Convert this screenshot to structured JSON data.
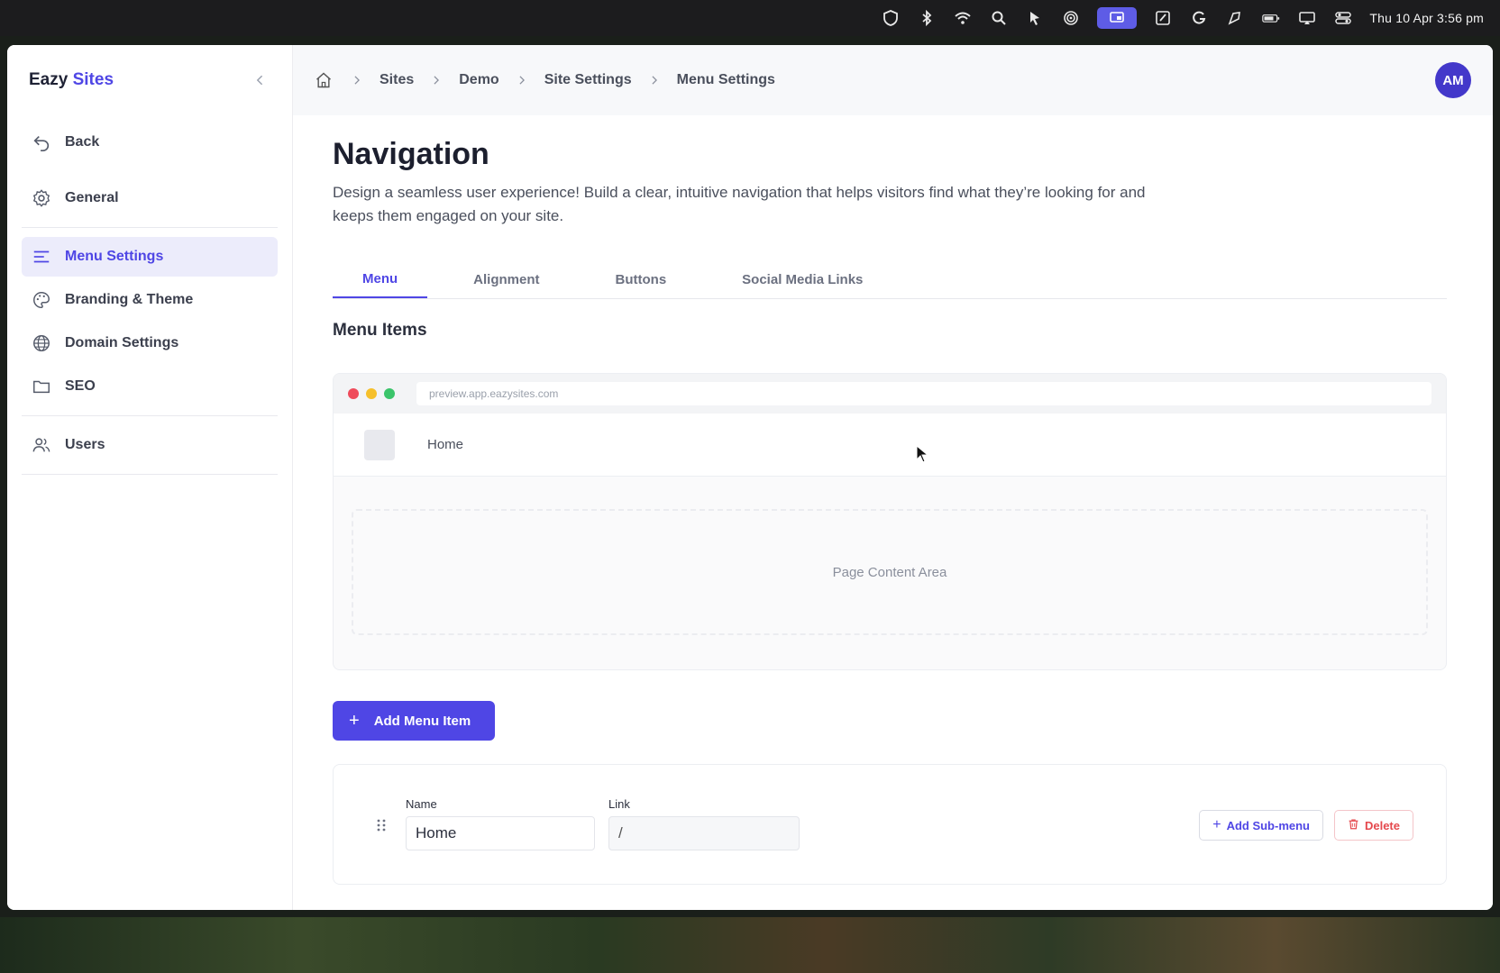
{
  "menubar": {
    "clock": "Thu 10 Apr  3:56 pm"
  },
  "app": {
    "logo_primary": "Eazy",
    "logo_accent": "Sites"
  },
  "sidebar": {
    "items": [
      {
        "label": "Back",
        "icon": "back-arrow-icon"
      },
      {
        "label": "General",
        "icon": "gear-icon"
      },
      {
        "label": "Menu Settings",
        "icon": "menu-lines-icon",
        "active": true
      },
      {
        "label": "Branding & Theme",
        "icon": "palette-icon"
      },
      {
        "label": "Domain Settings",
        "icon": "globe-icon"
      },
      {
        "label": "SEO",
        "icon": "folder-icon"
      },
      {
        "label": "Users",
        "icon": "users-icon"
      }
    ]
  },
  "breadcrumb": [
    "Sites",
    "Demo",
    "Site Settings",
    "Menu Settings"
  ],
  "user": {
    "initials": "AM"
  },
  "page": {
    "title": "Navigation",
    "description": "Design a seamless user experience! Build a clear, intuitive navigation that helps visitors find what they’re looking for and keeps them engaged on your site."
  },
  "tabs": [
    "Menu",
    "Alignment",
    "Buttons",
    "Social Media Links"
  ],
  "section_title": "Menu Items",
  "preview": {
    "url": "preview.app.eazysites.com",
    "nav_item": "Home",
    "content_label": "Page Content Area"
  },
  "add_button": "Add Menu Item",
  "menu_item": {
    "name_label": "Name",
    "name_value": "Home",
    "link_label": "Link",
    "link_value": "/",
    "add_sub_label": "Add Sub-menu",
    "delete_label": "Delete"
  },
  "colors": {
    "accent": "#4f46e5",
    "danger": "#e5484d"
  }
}
